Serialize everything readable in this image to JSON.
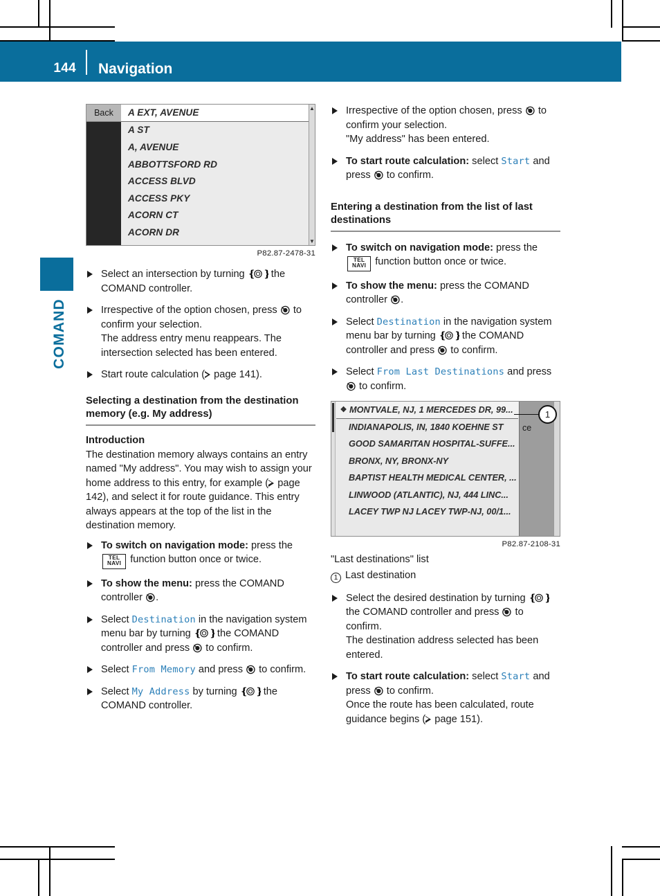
{
  "colors": {
    "brand": "#0a6e9c",
    "code": "#2b7fb8"
  },
  "header": {
    "page_number": "144",
    "title": "Navigation"
  },
  "sidebar": {
    "section_label": "COMAND"
  },
  "figures": {
    "street_list": {
      "ref": "P82.87-2478-31",
      "back_label": "Back",
      "scroll_up": "▲",
      "scroll_down": "▼",
      "rows": [
        "A EXT, AVENUE",
        "A ST",
        "A, AVENUE",
        "ABBOTTSFORD RD",
        "ACCESS BLVD",
        "ACCESS PKY",
        "ACORN CT",
        "ACORN DR"
      ]
    },
    "last_destinations": {
      "ref": "P82.87-2108-31",
      "callout_number": "1",
      "side_text": "ce",
      "pin_icon": "❖",
      "rows": [
        "MONTVALE, NJ, 1 MERCEDES DR, 99...",
        "INDIANAPOLIS, IN, 1840 KOEHNE ST",
        "GOOD SAMARITAN HOSPITAL-SUFFE...",
        "BRONX, NY, BRONX-NY",
        "BAPTIST HEALTH MEDICAL CENTER, ...",
        "LINWOOD (ATLANTIC), NJ, 444 LINC...",
        "LACEY TWP NJ LACEY TWP-NJ, 00/1..."
      ]
    }
  },
  "keys": {
    "tel": "TEL",
    "navi": "NAVI"
  },
  "left_column": {
    "b1": {
      "t1": "Select an intersection by turning ",
      "t2": " the COMAND controller."
    },
    "b2": {
      "t1": "Irrespective of the option chosen, press ",
      "t2": " to confirm your selection.",
      "t3": "The address entry menu reappears. The intersection selected has been entered."
    },
    "b3": {
      "t1": "Start route calculation (",
      "page": "page 141",
      "t2": ")."
    },
    "heading": "Selecting a destination from the destination memory (e.g. My address)",
    "subheading": "Introduction",
    "intro_1": "The destination memory always contains an entry named \"My address\". You may wish to assign your home address to this entry, for example (",
    "intro_page": "page 142",
    "intro_2": "), and select it for route guidance. This entry always appears at the top of the list in the destination memory.",
    "b4": {
      "bold": "To switch on navigation mode:",
      "t1": " press the ",
      "t2": " function button once or twice."
    },
    "b5": {
      "bold": "To show the menu:",
      "t1": " press the COMAND controller ",
      "t2": "."
    },
    "b6": {
      "t1": "Select ",
      "code": "Destination",
      "t2": " in the navigation system menu bar by turning ",
      "t3": " the COMAND controller and press ",
      "t4": " to confirm."
    },
    "b7": {
      "t1": "Select ",
      "code": "From Memory",
      "t2": " and press ",
      "t3": " to confirm."
    },
    "b8": {
      "t1": "Select ",
      "code": "My Address",
      "t2": " by turning ",
      "t3": " the COMAND controller."
    }
  },
  "right_column": {
    "b1": {
      "t1": "Irrespective of the option chosen, press ",
      "t2": " to confirm your selection.",
      "t3": "\"My address\" has been entered."
    },
    "b2": {
      "bold": "To start route calculation:",
      "t1": " select ",
      "code": "Start",
      "t2": " and press ",
      "t3": " to confirm."
    },
    "heading": "Entering a destination from the list of last destinations",
    "b3": {
      "bold": "To switch on navigation mode:",
      "t1": " press the ",
      "t2": " function button once or twice."
    },
    "b4": {
      "bold": "To show the menu:",
      "t1": " press the COMAND controller ",
      "t2": "."
    },
    "b5": {
      "t1": "Select ",
      "code": "Destination",
      "t2": " in the navigation system menu bar by turning ",
      "t3": " the COMAND controller and press ",
      "t4": " to confirm."
    },
    "b6": {
      "t1": "Select ",
      "code": "From Last Destinations",
      "t2": " and press ",
      "t3": " to confirm."
    },
    "caption_title": "\"Last destinations\" list",
    "caption_item": "Last destination",
    "caption_number": "1",
    "b7": {
      "t1": "Select the desired destination by turning ",
      "t2": " the COMAND controller and press ",
      "t3": " to confirm.",
      "t4": "The destination address selected has been entered."
    },
    "b8": {
      "bold": "To start route calculation:",
      "t1": " select ",
      "code": "Start",
      "t2": " and press ",
      "t3": " to confirm.",
      "t4": "Once the route has been calculated, route guidance begins (",
      "page": "page 151",
      "t5": ")."
    }
  }
}
